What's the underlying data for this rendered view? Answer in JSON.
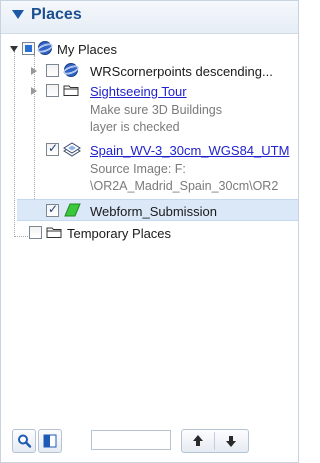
{
  "header": {
    "title": "Places",
    "collapse_icon": "triangle-down-icon"
  },
  "tree": {
    "my_places": {
      "label": "My Places",
      "icon": "globe-icon",
      "checkbox": "partial",
      "expanded": true
    },
    "items": [
      {
        "label": "WRScornerpoints descending...",
        "icon": "globe-icon",
        "checkbox": "unchecked",
        "is_link": false
      },
      {
        "label": "Sightseeing Tour",
        "icon": "folder-icon",
        "checkbox": "unchecked",
        "is_link": true,
        "description": [
          "Make sure 3D Buildings",
          "layer is checked"
        ]
      },
      {
        "label": "Spain_WV-3_30cm_WGS84_UTM",
        "icon": "image-overlay-icon",
        "checkbox": "checked",
        "is_link": true,
        "description": [
          "Source Image: F:",
          "\\OR2A_Madrid_Spain_30cm\\OR2"
        ]
      },
      {
        "label": "Webform_Submission",
        "icon": "polygon-icon",
        "checkbox": "checked",
        "is_link": false,
        "selected": true
      }
    ],
    "temporary_places": {
      "label": "Temporary Places",
      "icon": "folder-icon",
      "checkbox": "unchecked"
    }
  },
  "toolbar": {
    "search_icon": "search-icon",
    "layers_icon": "split-view-icon",
    "search_value": "",
    "up_icon": "arrow-up-icon",
    "down_icon": "arrow-down-icon"
  },
  "colors": {
    "header_text": "#1b4f8f",
    "link": "#2222cc",
    "selection": "#dbe8f8",
    "polygon_fill": "#3cc83c"
  }
}
